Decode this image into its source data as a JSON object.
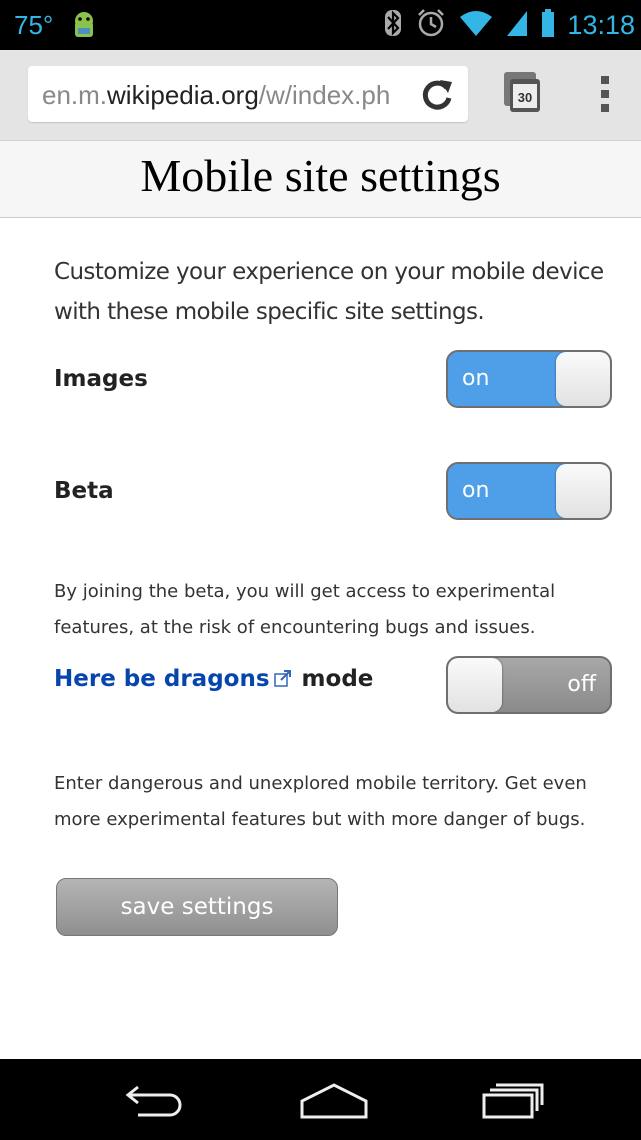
{
  "status_bar": {
    "temperature": "75°",
    "time": "13:18",
    "icons": [
      "android-icon",
      "bluetooth-icon",
      "alarm-icon",
      "wifi-icon",
      "signal-icon",
      "battery-icon"
    ]
  },
  "browser": {
    "url_prefix": "en.m.",
    "url_domain": "wikipedia.org",
    "url_rest": "/w/index.ph",
    "tab_count": "30",
    "icons": [
      "reload-icon",
      "tabs-icon",
      "overflow-menu-icon"
    ]
  },
  "page": {
    "title": "Mobile site settings",
    "intro": "Customize your experience on your mobile device with these mobile specific site settings.",
    "settings": [
      {
        "label": "Images",
        "state": "on"
      },
      {
        "label": "Beta",
        "state": "on"
      }
    ],
    "beta_description": "By joining the beta, you will get access to experimental features, at the risk of encountering bugs and issues.",
    "dragons": {
      "link_text": "Here be dragons",
      "suffix": "mode",
      "state": "off"
    },
    "dragons_description": "Enter dangerous and unexplored mobile territory. Get even more experimental features but with more danger of bugs.",
    "save_button": "save settings"
  },
  "colors": {
    "toggle_on": "#4f9fe8",
    "link": "#0645ad",
    "status_accent": "#33b5e5"
  },
  "nav_bar": {
    "icons": [
      "back-icon",
      "home-icon",
      "recent-apps-icon"
    ]
  }
}
